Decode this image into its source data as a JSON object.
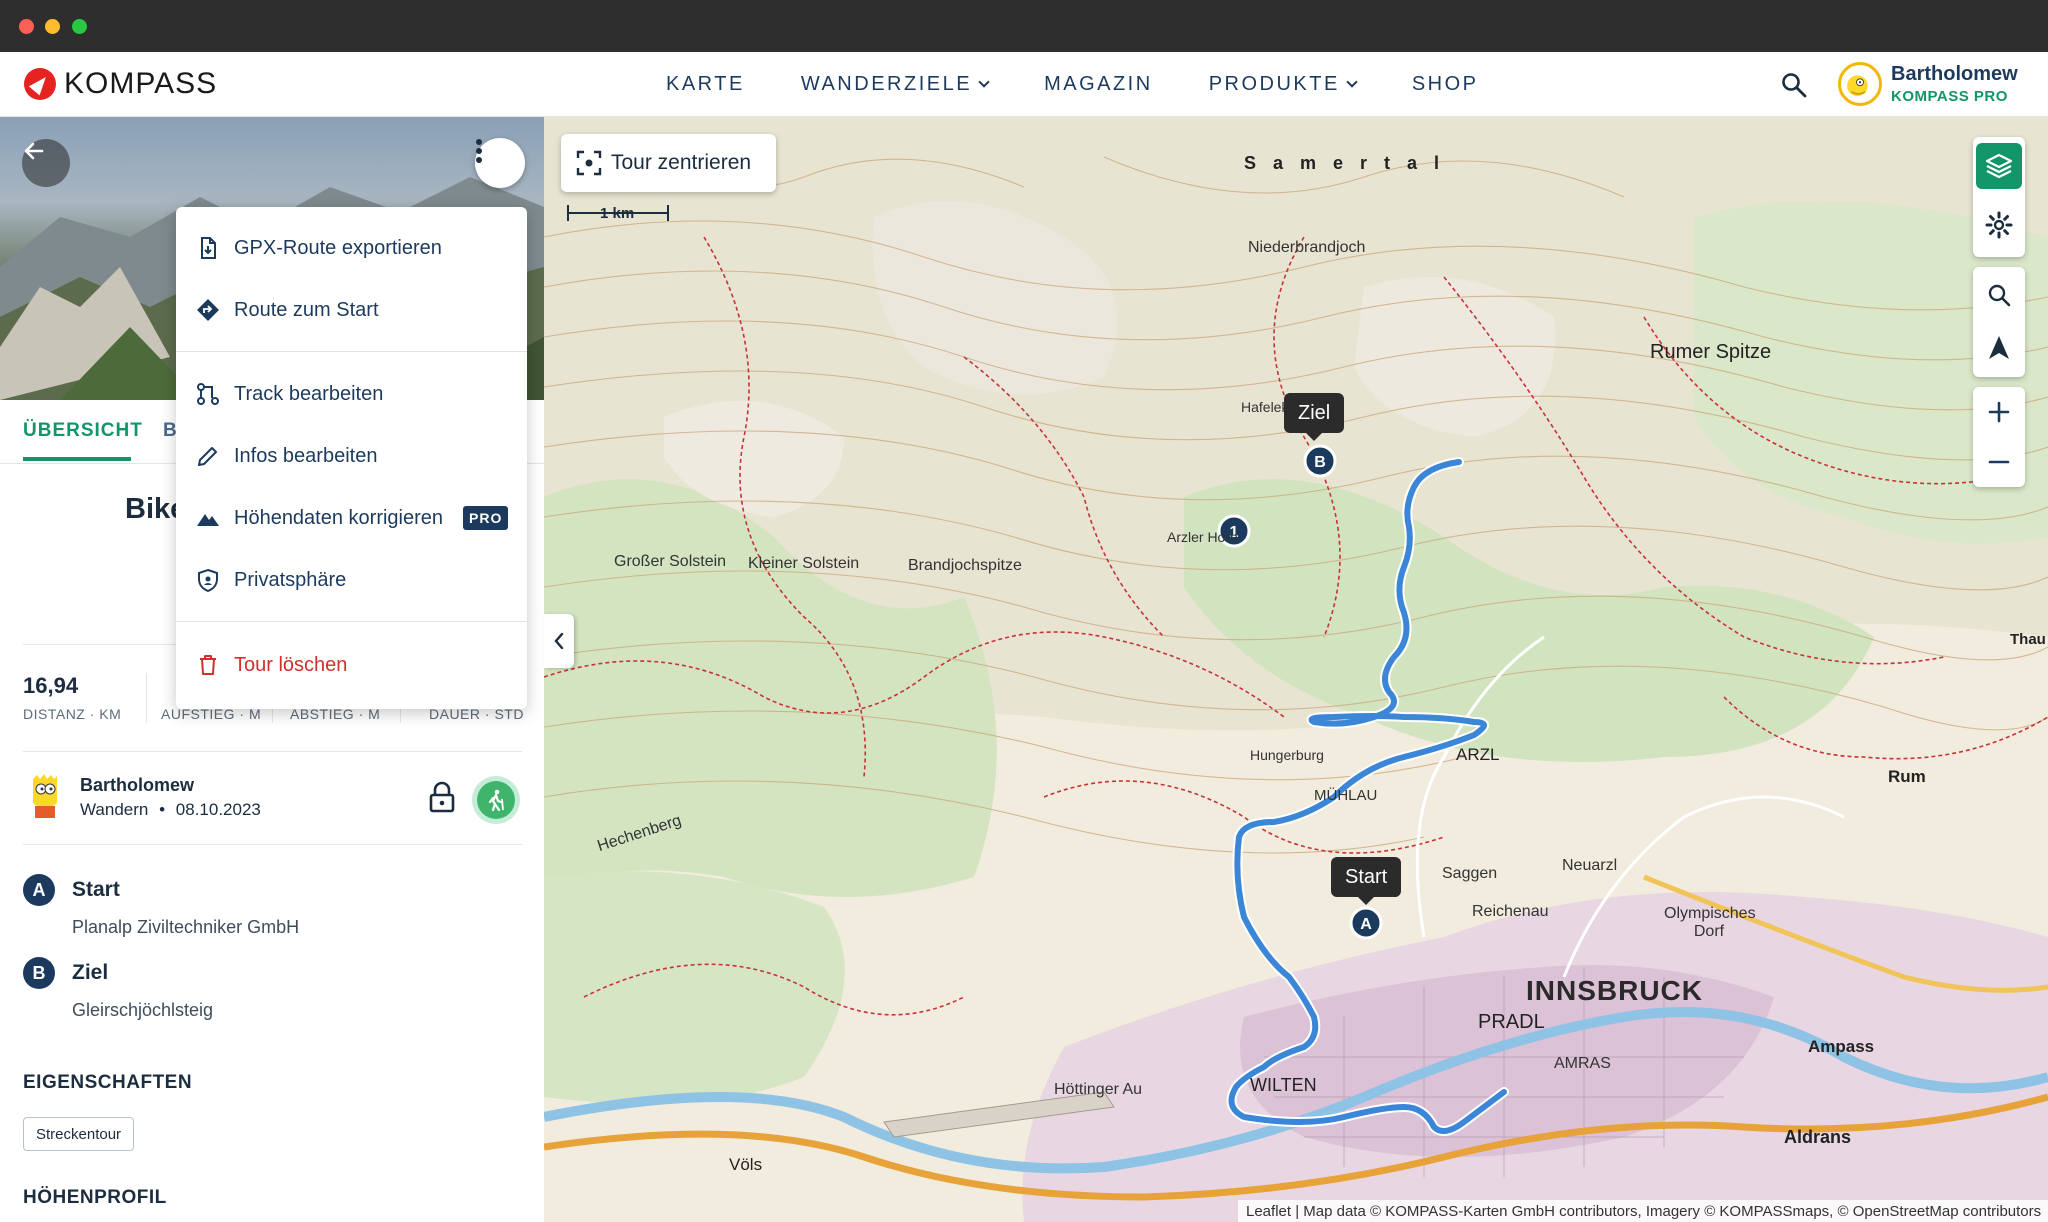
{
  "header": {
    "brand": "KOMPASS",
    "nav": [
      {
        "label": "KARTE",
        "has_dropdown": false
      },
      {
        "label": "WANDERZIELE",
        "has_dropdown": true
      },
      {
        "label": "MAGAZIN",
        "has_dropdown": false
      },
      {
        "label": "PRODUKTE",
        "has_dropdown": true
      },
      {
        "label": "SHOP",
        "has_dropdown": false
      }
    ],
    "user": {
      "name": "Bartholomew",
      "plan": "KOMPASS PRO"
    }
  },
  "panel": {
    "tabs": [
      {
        "label": "ÜBERSICHT",
        "active": true
      },
      {
        "label": "B",
        "active": false
      }
    ],
    "tour_title_visible": "Bike",
    "stats": [
      {
        "value": "16,94",
        "label": "DISTANZ · KM"
      },
      {
        "value": "",
        "label": "AUFSTIEG · M"
      },
      {
        "value": "",
        "label": "ABSTIEG · M"
      },
      {
        "value": "",
        "label": "DAUER · STD"
      }
    ],
    "author": {
      "name": "Bartholomew",
      "activity": "Wandern",
      "separator": "•",
      "date": "08.10.2023"
    },
    "waypoints": [
      {
        "badge": "A",
        "title": "Start",
        "subtitle": "Planalp Ziviltechniker GmbH"
      },
      {
        "badge": "B",
        "title": "Ziel",
        "subtitle": "Gleirschjöchlsteig"
      }
    ],
    "properties_title": "EIGENSCHAFTEN",
    "properties": [
      "Streckentour"
    ],
    "profile_title": "HÖHENPROFIL"
  },
  "menu": {
    "items": [
      {
        "label": "GPX-Route exportieren",
        "icon": "file-export-icon"
      },
      {
        "label": "Route zum Start",
        "icon": "directions-icon"
      },
      {
        "label": "Track bearbeiten",
        "icon": "track-edit-icon"
      },
      {
        "label": "Infos bearbeiten",
        "icon": "pencil-icon"
      },
      {
        "label": "Höhendaten korrigieren",
        "icon": "mountain-icon",
        "badge": "PRO"
      },
      {
        "label": "Privatsphäre",
        "icon": "shield-icon"
      },
      {
        "label": "Tour löschen",
        "icon": "trash-icon",
        "danger": true
      }
    ]
  },
  "map": {
    "center_button": "Tour zentrieren",
    "scale": "1 km",
    "tooltips": {
      "end": "Ziel",
      "start": "Start"
    },
    "markers": {
      "start": "A",
      "end": "B",
      "waypoint": "1"
    },
    "labels": {
      "city": "INNSBRUCK",
      "samertal": "S a m e r t a l",
      "niederbrandjoch": "Niederbrandjoch",
      "rumer_spitze": "Rumer Spitze",
      "hafelekarspitze": "Hafelekarspitze",
      "grosser_solstein": "Großer Solstein",
      "kleiner_solstein": "Kleiner Solstein",
      "brandjochspitze": "Brandjochspitze",
      "arzl": "ARZL",
      "rum": "Rum",
      "neuarzl": "Neuarzl",
      "pradl": "PRADL",
      "wilten": "WILTEN",
      "hottinger_au": "Höttinger Au",
      "amras": "AMRAS",
      "aldrans": "Aldrans",
      "ampass": "Ampass",
      "voels": "Völs",
      "reichenau": "Reichenau",
      "saggen": "Saggen",
      "hungerburg": "Hungerburg",
      "muehlau": "MÜHLAU",
      "arzler_horn": "Arzler Horn",
      "hechenberg": "Hechenberg",
      "olympisches_dorf": "Olympisches Dorf",
      "thaur": "Thau"
    },
    "attribution": "Leaflet | Map data © KOMPASS-Karten GmbH contributors, Imagery © KOMPASSmaps, © OpenStreetMap contributors"
  },
  "colors": {
    "accent_green": "#13956a",
    "brand_navy": "#1c3a5e",
    "brand_red": "#e52421",
    "route_blue": "#3b86d6",
    "danger_red": "#d0312d"
  }
}
